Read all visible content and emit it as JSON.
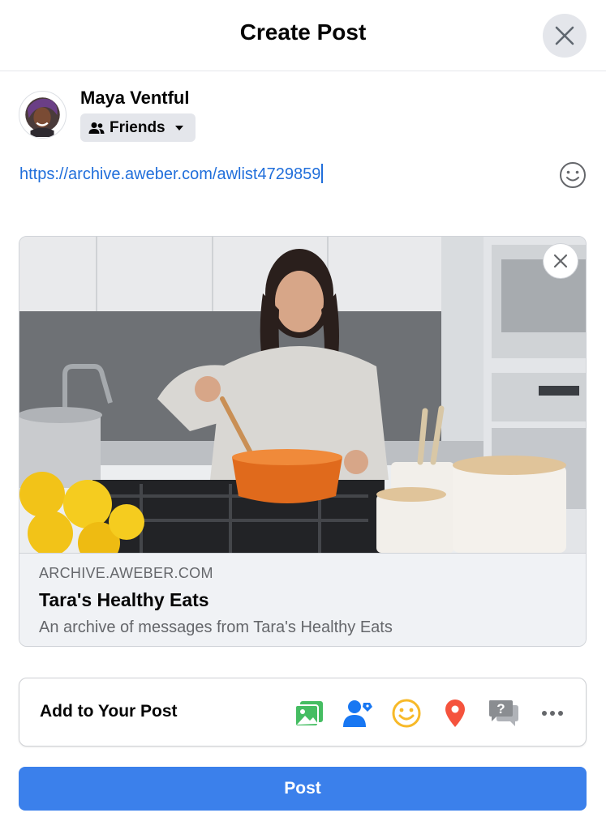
{
  "dialog": {
    "title": "Create Post"
  },
  "user": {
    "name": "Maya Ventful",
    "audience": "Friends"
  },
  "composer": {
    "text": "https://archive.aweber.com/awlist4729859"
  },
  "link_preview": {
    "domain": "ARCHIVE.AWEBER.COM",
    "title": "Tara's Healthy Eats",
    "description": "An archive of messages from Tara's Healthy Eats"
  },
  "add_to_post": {
    "label": "Add to Your Post",
    "icons": [
      "photo-video-icon",
      "tag-people-icon",
      "feeling-activity-icon",
      "check-in-icon",
      "ask-question-icon",
      "more-icon"
    ]
  },
  "actions": {
    "post_label": "Post"
  },
  "colors": {
    "primary": "#3b80eb",
    "link": "#216fdb",
    "photo_green": "#45bd62",
    "tag_blue": "#1877f2",
    "feeling_yellow": "#f7b928",
    "checkin_red": "#f5533d",
    "question_gray": "#65676b"
  }
}
